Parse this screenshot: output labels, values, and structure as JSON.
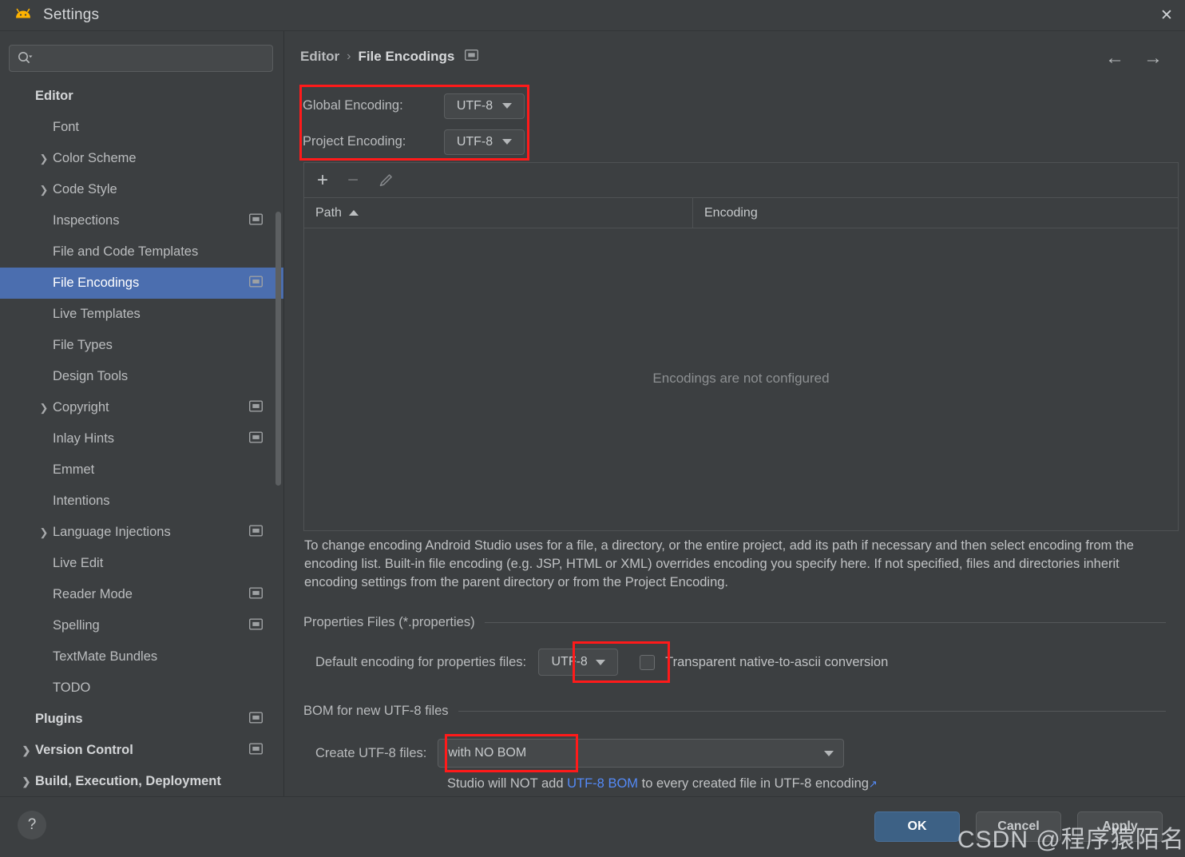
{
  "window": {
    "title": "Settings",
    "logo_icon": "android-studio-logo",
    "close_icon": "close-icon"
  },
  "search": {
    "value": "",
    "placeholder": "",
    "icon": "search-icon"
  },
  "sidebar": {
    "items": [
      {
        "label": "Editor",
        "level": 0,
        "bold": true,
        "expandable": false,
        "selected": false,
        "badge": false
      },
      {
        "label": "Font",
        "level": 1,
        "bold": false,
        "expandable": false,
        "selected": false,
        "badge": false
      },
      {
        "label": "Color Scheme",
        "level": 1,
        "bold": false,
        "expandable": true,
        "selected": false,
        "badge": false
      },
      {
        "label": "Code Style",
        "level": 1,
        "bold": false,
        "expandable": true,
        "selected": false,
        "badge": false
      },
      {
        "label": "Inspections",
        "level": 1,
        "bold": false,
        "expandable": false,
        "selected": false,
        "badge": true
      },
      {
        "label": "File and Code Templates",
        "level": 1,
        "bold": false,
        "expandable": false,
        "selected": false,
        "badge": false
      },
      {
        "label": "File Encodings",
        "level": 1,
        "bold": false,
        "expandable": false,
        "selected": true,
        "badge": true
      },
      {
        "label": "Live Templates",
        "level": 1,
        "bold": false,
        "expandable": false,
        "selected": false,
        "badge": false
      },
      {
        "label": "File Types",
        "level": 1,
        "bold": false,
        "expandable": false,
        "selected": false,
        "badge": false
      },
      {
        "label": "Design Tools",
        "level": 1,
        "bold": false,
        "expandable": false,
        "selected": false,
        "badge": false
      },
      {
        "label": "Copyright",
        "level": 1,
        "bold": false,
        "expandable": true,
        "selected": false,
        "badge": true
      },
      {
        "label": "Inlay Hints",
        "level": 1,
        "bold": false,
        "expandable": false,
        "selected": false,
        "badge": true
      },
      {
        "label": "Emmet",
        "level": 1,
        "bold": false,
        "expandable": false,
        "selected": false,
        "badge": false
      },
      {
        "label": "Intentions",
        "level": 1,
        "bold": false,
        "expandable": false,
        "selected": false,
        "badge": false
      },
      {
        "label": "Language Injections",
        "level": 1,
        "bold": false,
        "expandable": true,
        "selected": false,
        "badge": true
      },
      {
        "label": "Live Edit",
        "level": 1,
        "bold": false,
        "expandable": false,
        "selected": false,
        "badge": false
      },
      {
        "label": "Reader Mode",
        "level": 1,
        "bold": false,
        "expandable": false,
        "selected": false,
        "badge": true
      },
      {
        "label": "Spelling",
        "level": 1,
        "bold": false,
        "expandable": false,
        "selected": false,
        "badge": true
      },
      {
        "label": "TextMate Bundles",
        "level": 1,
        "bold": false,
        "expandable": false,
        "selected": false,
        "badge": false
      },
      {
        "label": "TODO",
        "level": 1,
        "bold": false,
        "expandable": false,
        "selected": false,
        "badge": false
      },
      {
        "label": "Plugins",
        "level": 0,
        "bold": true,
        "expandable": false,
        "selected": false,
        "badge": true
      },
      {
        "label": "Version Control",
        "level": 0,
        "bold": true,
        "expandable": true,
        "selected": false,
        "badge": true
      },
      {
        "label": "Build, Execution, Deployment",
        "level": 0,
        "bold": true,
        "expandable": true,
        "selected": false,
        "badge": false
      }
    ]
  },
  "breadcrumb": {
    "root": "Editor",
    "separator": "›",
    "current": "File Encodings",
    "badge_icon": "project-scope-icon"
  },
  "nav": {
    "back_icon": "←",
    "forward_icon": "→"
  },
  "encodings": {
    "global": {
      "label": "Global Encoding:",
      "value": "UTF-8"
    },
    "project": {
      "label": "Project Encoding:",
      "value": "UTF-8"
    }
  },
  "table": {
    "toolbar": {
      "add": "+",
      "remove": "−",
      "edit": "edit-pencil-icon"
    },
    "columns": [
      "Path",
      "Encoding"
    ],
    "sort_column": "Path",
    "sort_direction": "asc",
    "rows": [],
    "empty_text": "Encodings are not configured"
  },
  "description": "To change encoding Android Studio uses for a file, a directory, or the entire project, add its path if necessary and then select encoding from the encoding list. Built-in file encoding (e.g. JSP, HTML or XML) overrides encoding you specify here. If not specified, files and directories inherit encoding settings from the parent directory or from the Project Encoding.",
  "properties_section": {
    "title": "Properties Files (*.properties)",
    "default_encoding_label": "Default encoding for properties files:",
    "default_encoding_value": "UTF-8",
    "transparent_label": "Transparent native-to-ascii conversion",
    "transparent_checked": false
  },
  "bom_section": {
    "title": "BOM for new UTF-8 files",
    "create_label": "Create UTF-8 files:",
    "create_value": "with NO BOM",
    "note_prefix": "Studio will NOT add ",
    "note_link": "UTF-8 BOM",
    "note_suffix": " to every created file in UTF-8 encoding",
    "link_arrow": "↗"
  },
  "footer": {
    "help": "?",
    "ok": "OK",
    "cancel": "Cancel",
    "apply": "Apply"
  },
  "watermark": "CSDN @程序猿陌名！",
  "colors": {
    "accent": "#4b6eaf",
    "annotation": "#ff1a1a",
    "link": "#548af7",
    "background": "#3c3f41"
  }
}
